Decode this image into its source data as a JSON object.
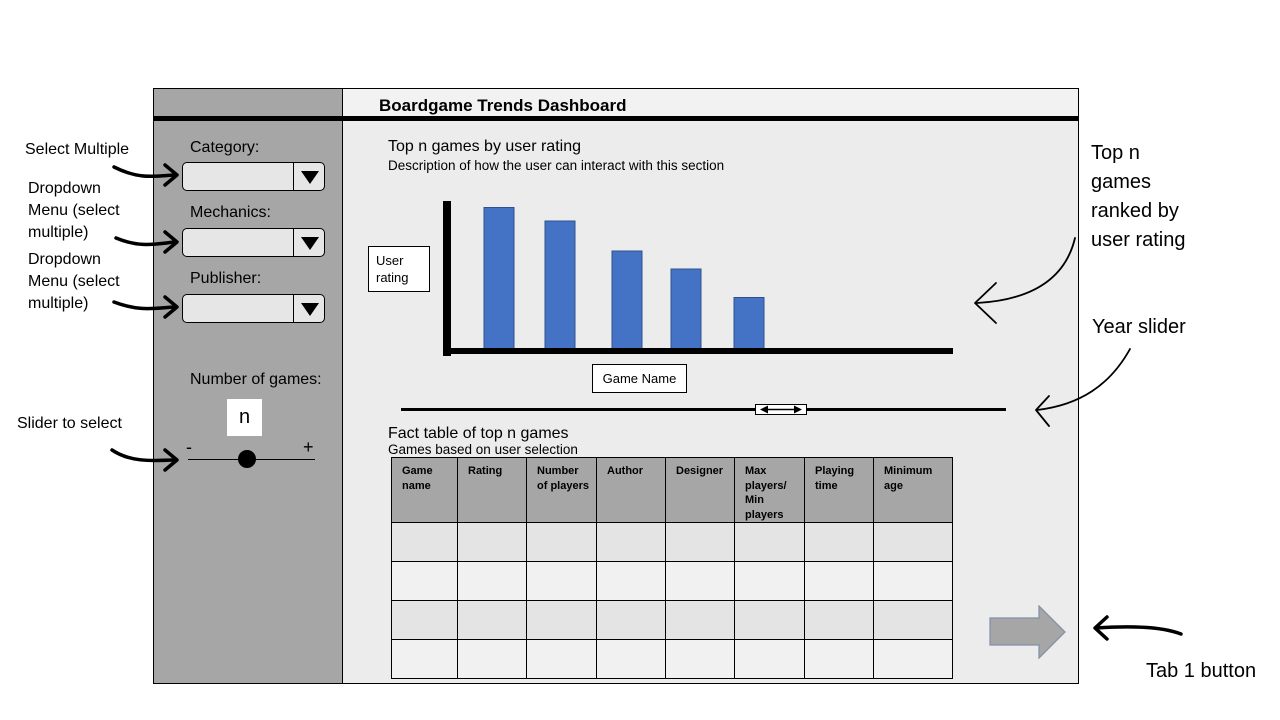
{
  "header": {
    "title": "Boardgame Trends Dashboard"
  },
  "sidebar": {
    "category_label": "Category:",
    "mechanics_label": "Mechanics:",
    "publisher_label": "Publisher:",
    "number_label": "Number of games:",
    "n_value": "n",
    "slider_minus": "-",
    "slider_plus": "+"
  },
  "annotations": {
    "select_multiple": "Select Multiple",
    "dropdown_1": [
      "Dropdown",
      "Menu (select",
      "multiple)"
    ],
    "dropdown_2": [
      "Dropdown",
      "Menu (select",
      "multiple)"
    ],
    "slider_select": "Slider to select",
    "top_n": [
      "Top n",
      "games",
      "ranked by",
      "user rating"
    ],
    "year_slider": "Year slider",
    "tab_button": "Tab 1 button"
  },
  "chart": {
    "title": "Top n games  by user rating",
    "description": "Description of how the user can interact with this section"
  },
  "chart_data": {
    "type": "bar",
    "categories": [
      "",
      "",
      "",
      "",
      ""
    ],
    "values": [
      0.95,
      0.86,
      0.66,
      0.54,
      0.35
    ],
    "ylim": [
      0,
      1
    ],
    "ylabel": "User rating",
    "xlabel": "Game Name",
    "title": "Top n games  by user rating",
    "bar_color": "#4472c4",
    "grid": false
  },
  "table": {
    "title": "Fact table of top n games",
    "subtitle": "Games based on user selection",
    "columns": [
      "Game name",
      "Rating",
      "Number of players",
      "Author",
      "Designer",
      "Max players/ Min players",
      "Playing time",
      "Minimum age"
    ],
    "rows": [
      [
        "",
        "",
        "",
        "",
        "",
        "",
        "",
        ""
      ],
      [
        "",
        "",
        "",
        "",
        "",
        "",
        "",
        ""
      ],
      [
        "",
        "",
        "",
        "",
        "",
        "",
        "",
        ""
      ],
      [
        "",
        "",
        "",
        "",
        "",
        "",
        "",
        ""
      ]
    ]
  },
  "colors": {
    "sidebar": "#a6a6a6",
    "content": "#ececec",
    "accent_bar": "#4472c4",
    "tab_arrow": "#a6a6a6",
    "tab_arrow_border": "#7f8fa6"
  }
}
